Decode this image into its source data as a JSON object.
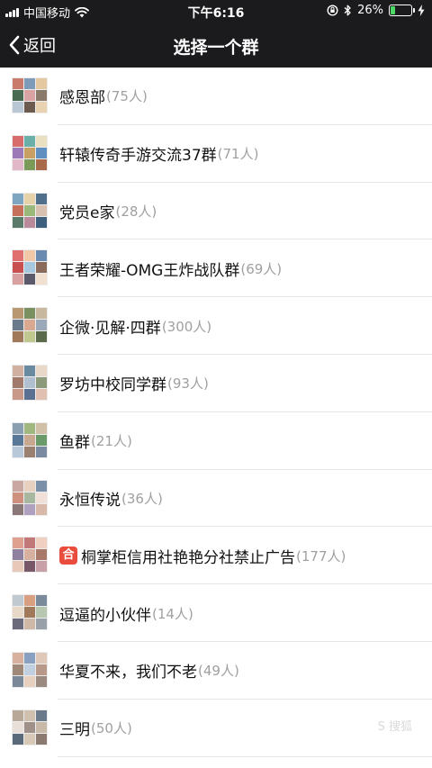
{
  "status_bar": {
    "carrier": "中国移动",
    "time": "下午6:16",
    "battery": "26%",
    "battery_level": 0.26,
    "icons": [
      "signal-icon",
      "wifi-icon",
      "rotation-lock-icon",
      "bluetooth-icon",
      "battery-icon",
      "charging-icon"
    ]
  },
  "nav": {
    "back_label": "返回",
    "title": "选择一个群"
  },
  "colors": {
    "bar_bg": "#1b1b1d",
    "count_gray": "#a0a0a0",
    "divider": "#e6e6e6",
    "badge_red": "#e94b3c"
  },
  "groups": [
    {
      "name": "感恩部",
      "count": "(75人)"
    },
    {
      "name": "轩辕传奇手游交流37群",
      "count": "(71人)"
    },
    {
      "name": "党员e家",
      "count": "(28人)"
    },
    {
      "name": "王者荣耀-OMG王炸战队群",
      "count": "(69人)"
    },
    {
      "name": "企微·见解·四群",
      "count": "(300人)"
    },
    {
      "name": "罗坊中校同学群",
      "count": "(93人)"
    },
    {
      "name": "鱼群",
      "count": "(21人)"
    },
    {
      "name": "永恒传说",
      "count": "(36人)"
    },
    {
      "name": "桐掌柜信用社艳艳分社禁止广告",
      "count": "(177人)",
      "badge": "合"
    },
    {
      "name": "逗逼的小伙伴",
      "count": "(14人)"
    },
    {
      "name": "华夏不来，我们不老",
      "count": "(49人)"
    },
    {
      "name": "三明",
      "count": "(50人)"
    }
  ]
}
